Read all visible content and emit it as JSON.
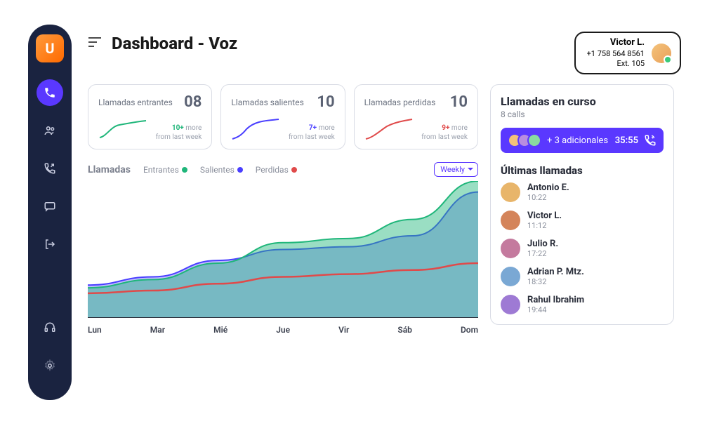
{
  "page_title": "Dashboard - Voz",
  "user": {
    "name": "Victor L.",
    "phone": "+1 758 564 8561",
    "ext": "Ext. 105"
  },
  "sidebar": {
    "logo_letter": "U",
    "items": [
      {
        "name": "phone-icon",
        "active": true
      },
      {
        "name": "users-icon",
        "active": false
      },
      {
        "name": "call-forward-icon",
        "active": false
      },
      {
        "name": "chat-icon",
        "active": false
      },
      {
        "name": "logout-icon",
        "active": false
      }
    ],
    "bottom": [
      {
        "name": "headset-icon"
      },
      {
        "name": "gear-icon"
      }
    ]
  },
  "cards": [
    {
      "label": "Llamadas entrantes",
      "value": "08",
      "delta_num": "10+",
      "delta_more": "more",
      "delta_sub": "from last week",
      "color": "green"
    },
    {
      "label": "Llamadas salientes",
      "value": "10",
      "delta_num": "7+",
      "delta_more": "more",
      "delta_sub": "from last week",
      "color": "blue"
    },
    {
      "label": "Llamadas perdidas",
      "value": "10",
      "delta_num": "9+",
      "delta_more": "more",
      "delta_sub": "from last week",
      "color": "red"
    }
  ],
  "chart_header": {
    "title": "Llamadas",
    "legend": [
      {
        "label": "Entrantes",
        "color": "green"
      },
      {
        "label": "Salientes",
        "color": "blue"
      },
      {
        "label": "Perdidas",
        "color": "red"
      }
    ],
    "period": "Weekly"
  },
  "chart_data": {
    "type": "area",
    "title": "Llamadas",
    "xlabel": "",
    "ylabel": "",
    "ylim": [
      0,
      100
    ],
    "categories": [
      "Lun",
      "Mar",
      "Mié",
      "Jue",
      "Vir",
      "Sáb",
      "Dom"
    ],
    "series": [
      {
        "name": "Entrantes",
        "color": "#1fb67a",
        "values": [
          22,
          28,
          40,
          55,
          58,
          72,
          100
        ]
      },
      {
        "name": "Salientes",
        "color": "#4a3fff",
        "values": [
          24,
          30,
          42,
          50,
          52,
          60,
          92
        ]
      },
      {
        "name": "Perdidas",
        "color": "#e04a4a",
        "values": [
          18,
          20,
          25,
          30,
          32,
          35,
          40
        ]
      }
    ]
  },
  "ongoing": {
    "title": "Llamadas en curso",
    "sub": "8 calls",
    "extra": "+ 3 adicionales",
    "timer": "35:55"
  },
  "recent": {
    "title": "Últimas llamadas",
    "items": [
      {
        "name": "Antonio E.",
        "time": "10:22"
      },
      {
        "name": "Victor L.",
        "time": "11:12"
      },
      {
        "name": "Julio R.",
        "time": "17:22"
      },
      {
        "name": "Adrian P. Mtz.",
        "time": "18:32"
      },
      {
        "name": "Rahul Ibrahim",
        "time": "19:44"
      }
    ]
  }
}
